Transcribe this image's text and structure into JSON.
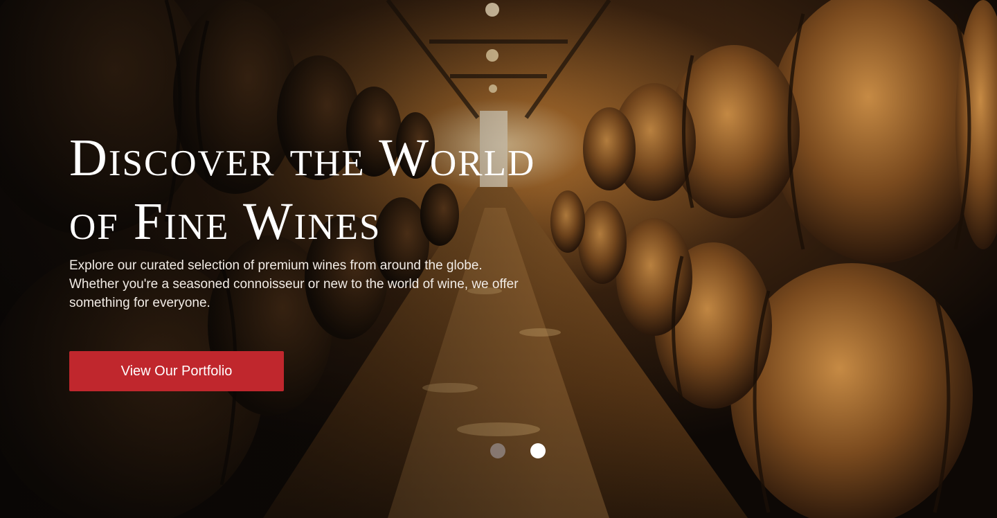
{
  "hero": {
    "headline_line1": "Discover the World",
    "headline_line2": "of Fine Wines",
    "description": "Explore our curated selection of premium wines from around the globe. Whether you're a seasoned connoisseur or new to the world of wine, we offer something for everyone.",
    "cta_label": "View Our Portfolio",
    "accent_color": "#c0272d",
    "background_image": "wine-barrel-cellar-photo"
  },
  "carousel": {
    "slide_count": 2,
    "active_index": 1
  }
}
